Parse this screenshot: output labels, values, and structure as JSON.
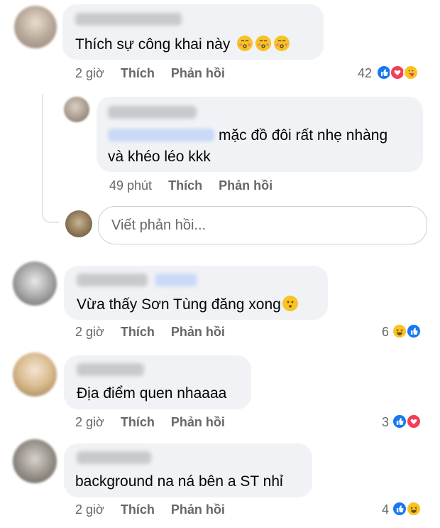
{
  "comments": [
    {
      "text": "Thích sự công khai này",
      "emojis": [
        "kissing-face",
        "kissing-face",
        "kissing-face"
      ],
      "time": "2 giờ",
      "like_label": "Thích",
      "reply_label": "Phản hồi",
      "reaction_count": "42",
      "reactions": [
        "like",
        "love",
        "care"
      ]
    },
    {
      "reply": true,
      "text_line1": "mặc đồ đôi rất nhẹ nhàng",
      "text_line2": "và khéo léo kkk",
      "time": "49 phút",
      "like_label": "Thích",
      "reply_label": "Phản hồi"
    },
    {
      "text": "Vừa thấy Sơn Tùng đăng xong",
      "emojis": [
        "hushed-face"
      ],
      "time": "2 giờ",
      "like_label": "Thích",
      "reply_label": "Phản hồi",
      "reaction_count": "6",
      "reactions": [
        "haha",
        "like"
      ]
    },
    {
      "text": "Địa điểm quen nhaaaa",
      "time": "2 giờ",
      "like_label": "Thích",
      "reply_label": "Phản hồi",
      "reaction_count": "3",
      "reactions": [
        "like",
        "love"
      ]
    },
    {
      "text": "background na ná bên a ST nhỉ",
      "time": "2 giờ",
      "like_label": "Thích",
      "reply_label": "Phản hồi",
      "reaction_count": "4",
      "reactions": [
        "like",
        "haha"
      ]
    }
  ],
  "reply_box": {
    "placeholder": "Viết phản hồi..."
  },
  "colors": {
    "bubble": "#f0f2f5",
    "meta": "#65676b",
    "like_blue": "#1877f2",
    "love_red": "#f33e58",
    "emoji_yellow": "#f7c325"
  }
}
